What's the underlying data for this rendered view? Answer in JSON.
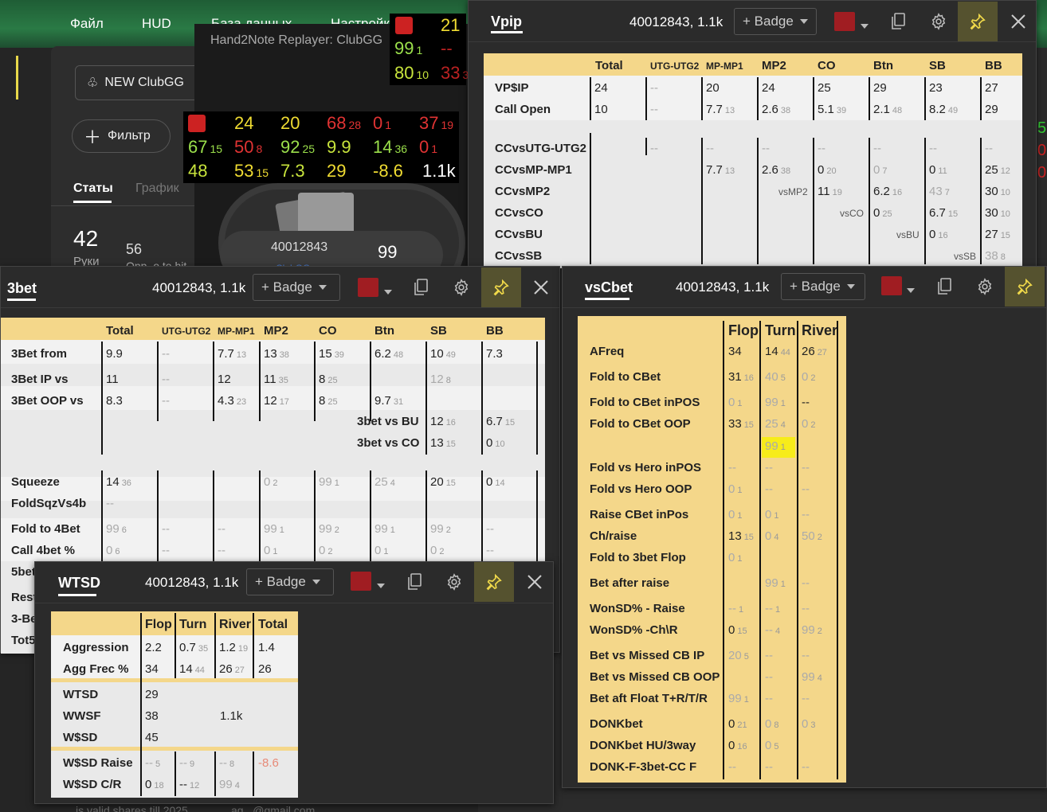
{
  "app": {
    "menu": [
      "Файл",
      "HUD",
      "База данных",
      "Настройки"
    ],
    "client_button": "NEW ClubGG",
    "filter_button": "Фильтр",
    "tabs": [
      "Статы",
      "График"
    ],
    "hands_count": "42",
    "hands_label": "Руки",
    "second_count": "56",
    "second_label": "Opp. o to hit"
  },
  "replayer": {
    "title": "Hand2Note Replayer: ClubGG",
    "player_id": "40012843",
    "player_stack": "99",
    "player_sub": "ClubGG"
  },
  "hud_small": [
    [
      {
        "v": "21",
        "c": "y"
      }
    ],
    [
      {
        "v": "99",
        "s": "1",
        "c": "g"
      },
      {
        "v": "--",
        "c": "dr"
      }
    ],
    [
      {
        "v": "80",
        "s": "10",
        "c": "lg"
      },
      {
        "v": "33",
        "s": "3",
        "c": "dr"
      }
    ]
  ],
  "hud_main": [
    [
      {
        "v": "24",
        "c": "y"
      },
      {
        "v": "20",
        "c": "y"
      },
      {
        "v": "68",
        "s": "28",
        "c": "r"
      },
      {
        "v": "0",
        "s": "1",
        "c": "r"
      },
      {
        "v": "37",
        "s": "19",
        "c": "r"
      }
    ],
    [
      {
        "v": "67",
        "s": "15",
        "c": "g"
      },
      {
        "v": "50",
        "s": "8",
        "c": "r"
      },
      {
        "v": "92",
        "s": "25",
        "c": "g"
      },
      {
        "v": "9.9",
        "c": "lg"
      },
      {
        "v": "14",
        "s": "36",
        "c": "g"
      },
      {
        "v": "0",
        "s": "1",
        "c": "r"
      }
    ],
    [
      {
        "v": "48",
        "c": "lg"
      },
      {
        "v": "53",
        "s": "15",
        "c": "y"
      },
      {
        "v": "7.3",
        "c": "lg"
      },
      {
        "v": "29",
        "c": "y"
      },
      {
        "v": "-8.6",
        "c": "y"
      },
      {
        "v": "1.1k",
        "c": "w"
      }
    ]
  ],
  "popups": {
    "vpip": {
      "title": "Vpip",
      "player": "40012843, 1.1k",
      "badge": "+ Badge",
      "columns": [
        "Total",
        "UTG-UTG2",
        "MP-MP1",
        "MP2",
        "CO",
        "Btn",
        "SB",
        "BB"
      ],
      "rows": [
        {
          "label": "VP$IP",
          "cells": [
            [
              "24"
            ],
            [
              "--"
            ],
            [
              "20"
            ],
            [
              "24"
            ],
            [
              "25"
            ],
            [
              "29"
            ],
            [
              "23"
            ],
            [
              "27"
            ]
          ]
        },
        {
          "label": "Call Open",
          "cells": [
            [
              "10"
            ],
            [
              "--"
            ],
            [
              "7.7",
              "13"
            ],
            [
              "2.6",
              "38"
            ],
            [
              "5.1",
              "39"
            ],
            [
              "2.1",
              "48"
            ],
            [
              "8.2",
              "49"
            ],
            [
              "29"
            ]
          ]
        },
        {
          "label": "CCvsUTG-UTG2",
          "cells": [
            [
              ""
            ],
            [
              "--"
            ],
            [
              "--"
            ],
            [
              "--"
            ],
            [
              "--"
            ],
            [
              "--"
            ],
            [
              "--"
            ],
            [
              "--"
            ]
          ]
        },
        {
          "label": "CCvsMP-MP1",
          "cells": [
            [
              ""
            ],
            [
              ""
            ],
            [
              "7.7",
              "13"
            ],
            [
              "2.6",
              "38"
            ],
            [
              "0",
              "20"
            ],
            [
              "0",
              "7"
            ],
            [
              "0",
              "11"
            ],
            [
              "25",
              "12"
            ]
          ]
        },
        {
          "label": "CCvsMP2",
          "cells": [
            [
              ""
            ],
            [
              ""
            ],
            [
              ""
            ],
            [
              "vsMP2"
            ],
            [
              "11",
              "19"
            ],
            [
              "6.2",
              "16"
            ],
            [
              "43",
              "7"
            ],
            [
              "30",
              "10"
            ]
          ]
        },
        {
          "label": "CCvsCO",
          "cells": [
            [
              ""
            ],
            [
              ""
            ],
            [
              ""
            ],
            [
              ""
            ],
            [
              "vsCO"
            ],
            [
              "0",
              "25"
            ],
            [
              "6.7",
              "15"
            ],
            [
              "30",
              "10"
            ]
          ]
        },
        {
          "label": "CCvsBU",
          "cells": [
            [
              ""
            ],
            [
              ""
            ],
            [
              ""
            ],
            [
              ""
            ],
            [
              ""
            ],
            [
              "vsBU"
            ],
            [
              "0",
              "16"
            ],
            [
              "27",
              "15"
            ]
          ]
        },
        {
          "label": "CCvsSB",
          "cells": [
            [
              ""
            ],
            [
              ""
            ],
            [
              ""
            ],
            [
              ""
            ],
            [
              ""
            ],
            [
              ""
            ],
            [
              "vsSB"
            ],
            [
              "38",
              "8"
            ]
          ]
        }
      ]
    },
    "threebet": {
      "title": "3bet",
      "player": "40012843, 1.1k",
      "badge": "+ Badge",
      "columns": [
        "Total",
        "UTG-UTG2",
        "MP-MP1",
        "MP2",
        "CO",
        "Btn",
        "SB",
        "BB"
      ],
      "rows": [
        {
          "label": "3Bet from",
          "cells": [
            [
              "9.9"
            ],
            [
              "--"
            ],
            [
              "7.7",
              "13"
            ],
            [
              "13",
              "38"
            ],
            [
              "15",
              "39"
            ],
            [
              "6.2",
              "48"
            ],
            [
              "10",
              "49"
            ],
            [
              "7.3"
            ]
          ]
        },
        {
          "label": "3Bet IP vs",
          "cells": [
            [
              "11"
            ],
            [
              "--"
            ],
            [
              "12"
            ],
            [
              "11",
              "35"
            ],
            [
              "8",
              "25"
            ],
            [
              ""
            ],
            [
              "12",
              "8"
            ],
            [
              ""
            ]
          ]
        },
        {
          "label": "3Bet OOP vs",
          "cells": [
            [
              "8.3"
            ],
            [
              "--"
            ],
            [
              "4.3",
              "23"
            ],
            [
              "12",
              "17"
            ],
            [
              "8",
              "25"
            ],
            [
              "9.7",
              "31"
            ],
            [
              ""
            ],
            [
              ""
            ]
          ]
        },
        {
          "label": "3bet vs BU",
          "cells": [
            [
              "12",
              "16"
            ],
            [
              "6.7",
              "15"
            ]
          ]
        },
        {
          "label": "3bet vs CO",
          "cells": [
            [
              "13",
              "15"
            ],
            [
              "0",
              "10"
            ]
          ]
        },
        {
          "label": "Squeeze",
          "cells": [
            [
              "14",
              "36"
            ],
            [
              ""
            ],
            [
              ""
            ],
            [
              "0",
              "2"
            ],
            [
              "99",
              "1"
            ],
            [
              "25",
              "4"
            ],
            [
              "20",
              "15"
            ],
            [
              "0",
              "14"
            ]
          ]
        },
        {
          "label": "FoldSqzVs4b",
          "cells": [
            [
              "--"
            ]
          ]
        },
        {
          "label": "Fold to 4Bet",
          "cells": [
            [
              "99",
              "6"
            ],
            [
              "--"
            ],
            [
              "--"
            ],
            [
              "99",
              "1"
            ],
            [
              "99",
              "2"
            ],
            [
              "99",
              "1"
            ],
            [
              "99",
              "2"
            ],
            [
              "--"
            ]
          ]
        },
        {
          "label": "Call 4bet %",
          "cells": [
            [
              "0",
              "6"
            ],
            [
              "--"
            ],
            [
              "--"
            ],
            [
              "0",
              "1"
            ],
            [
              "0",
              "2"
            ],
            [
              "0",
              "1"
            ],
            [
              "0",
              "2"
            ],
            [
              "--"
            ]
          ]
        },
        {
          "label": "5bet",
          "cells": []
        },
        {
          "label": "Rest",
          "cells": []
        },
        {
          "label": "3-Be",
          "cells": []
        },
        {
          "label": "Tot5",
          "cells": []
        }
      ]
    },
    "vscbet": {
      "title": "vsCbet",
      "player": "40012843, 1.1k",
      "badge": "+ Badge",
      "columns": [
        "Flop",
        "Turn",
        "River"
      ],
      "rows": [
        {
          "label": "AFreq",
          "cells": [
            [
              "34"
            ],
            [
              "14",
              "44"
            ],
            [
              "26",
              "27"
            ]
          ]
        },
        {
          "label": "Fold to CBet",
          "cells": [
            [
              "31",
              "16"
            ],
            [
              "40",
              "5"
            ],
            [
              "0",
              "2"
            ]
          ]
        },
        {
          "label": "Fold to CBet inPOS",
          "cells": [
            [
              "0",
              "1"
            ],
            [
              "99",
              "1"
            ],
            [
              "--"
            ]
          ]
        },
        {
          "label": "Fold to CBet OOP",
          "cells": [
            [
              "33",
              "15"
            ],
            [
              "25",
              "4"
            ],
            [
              "0",
              "2"
            ]
          ]
        },
        {
          "label": "",
          "cells": [
            [
              ""
            ],
            [
              "99",
              "1"
            ],
            [
              ""
            ]
          ]
        },
        {
          "label": "Fold vs Hero inPOS",
          "cells": [
            [
              "--"
            ],
            [
              "--"
            ],
            [
              "--"
            ]
          ]
        },
        {
          "label": "Fold vs Hero OOP",
          "cells": [
            [
              "0",
              "1"
            ],
            [
              "--"
            ],
            [
              "--"
            ]
          ]
        },
        {
          "label": "Raise CBet inPos",
          "cells": [
            [
              "0",
              "1"
            ],
            [
              "0",
              "1"
            ],
            [
              "--"
            ]
          ]
        },
        {
          "label": "Ch/raise",
          "cells": [
            [
              "13",
              "15"
            ],
            [
              "0",
              "4"
            ],
            [
              "50",
              "2"
            ]
          ]
        },
        {
          "label": "Fold to 3bet Flop",
          "cells": [
            [
              "0",
              "1"
            ],
            [
              ""
            ],
            [
              ""
            ]
          ]
        },
        {
          "label": "Bet after raise",
          "cells": [
            [
              ""
            ],
            [
              "99",
              "1"
            ],
            [
              "--"
            ]
          ]
        },
        {
          "label": "WonSD% - Raise",
          "cells": [
            [
              "--",
              "1"
            ],
            [
              "--",
              "1"
            ],
            [
              "--"
            ]
          ]
        },
        {
          "label": "WonSD% -Ch\\R",
          "cells": [
            [
              "0",
              "15"
            ],
            [
              "--",
              "4"
            ],
            [
              "99",
              "2"
            ]
          ]
        },
        {
          "label": "Bet vs Missed CB IP",
          "cells": [
            [
              "20",
              "5"
            ],
            [
              "--"
            ],
            [
              "--"
            ]
          ]
        },
        {
          "label": "Bet vs Missed CB OOP",
          "cells": [
            [
              ""
            ],
            [
              "--"
            ],
            [
              "99",
              "4"
            ]
          ]
        },
        {
          "label": "Bet aft Float T+R/T/R",
          "cells": [
            [
              "99",
              "1"
            ],
            [
              "--"
            ],
            [
              "--"
            ]
          ]
        },
        {
          "label": "DONKbet",
          "cells": [
            [
              "0",
              "21"
            ],
            [
              "0",
              "8"
            ],
            [
              "0",
              "3"
            ]
          ]
        },
        {
          "label": "DONKbet HU/3way",
          "cells": [
            [
              "0",
              "16"
            ],
            [
              "0",
              "5"
            ],
            [
              ""
            ]
          ]
        },
        {
          "label": "DONK-F-3bet-CC F",
          "cells": [
            [
              "--"
            ],
            [
              "--"
            ],
            [
              "--"
            ]
          ]
        }
      ]
    },
    "wtsd": {
      "title": "WTSD",
      "player": "40012843, 1.1k",
      "badge": "+ Badge",
      "columns": [
        "Flop",
        "Turn",
        "River",
        "Total"
      ],
      "rows": [
        {
          "label": "Aggression",
          "cells": [
            [
              "2.2"
            ],
            [
              "0.7",
              "35"
            ],
            [
              "1.2",
              "19"
            ],
            [
              "1.4"
            ]
          ]
        },
        {
          "label": "Agg Frec %",
          "cells": [
            [
              "34"
            ],
            [
              "14",
              "44"
            ],
            [
              "26",
              "27"
            ],
            [
              "26"
            ]
          ]
        },
        {
          "label": "WTSD",
          "cells": [
            [
              "29"
            ]
          ]
        },
        {
          "label": "WWSF",
          "cells": [
            [
              "38"
            ],
            [
              "1.1k"
            ]
          ]
        },
        {
          "label": "W$SD",
          "cells": [
            [
              "45"
            ]
          ]
        },
        {
          "label": "W$SD Raise",
          "cells": [
            [
              "--",
              "5"
            ],
            [
              "--",
              "9"
            ],
            [
              "--",
              "8"
            ],
            [
              "-8.6"
            ]
          ]
        },
        {
          "label": "W$SD C/R",
          "cells": [
            [
              "0",
              "18"
            ],
            [
              "--",
              "12"
            ],
            [
              "99",
              "4"
            ],
            [
              ""
            ]
          ]
        }
      ]
    }
  },
  "footer": {
    "left": "is valid shares till 2025",
    "email": "ag...@gmail.com"
  }
}
